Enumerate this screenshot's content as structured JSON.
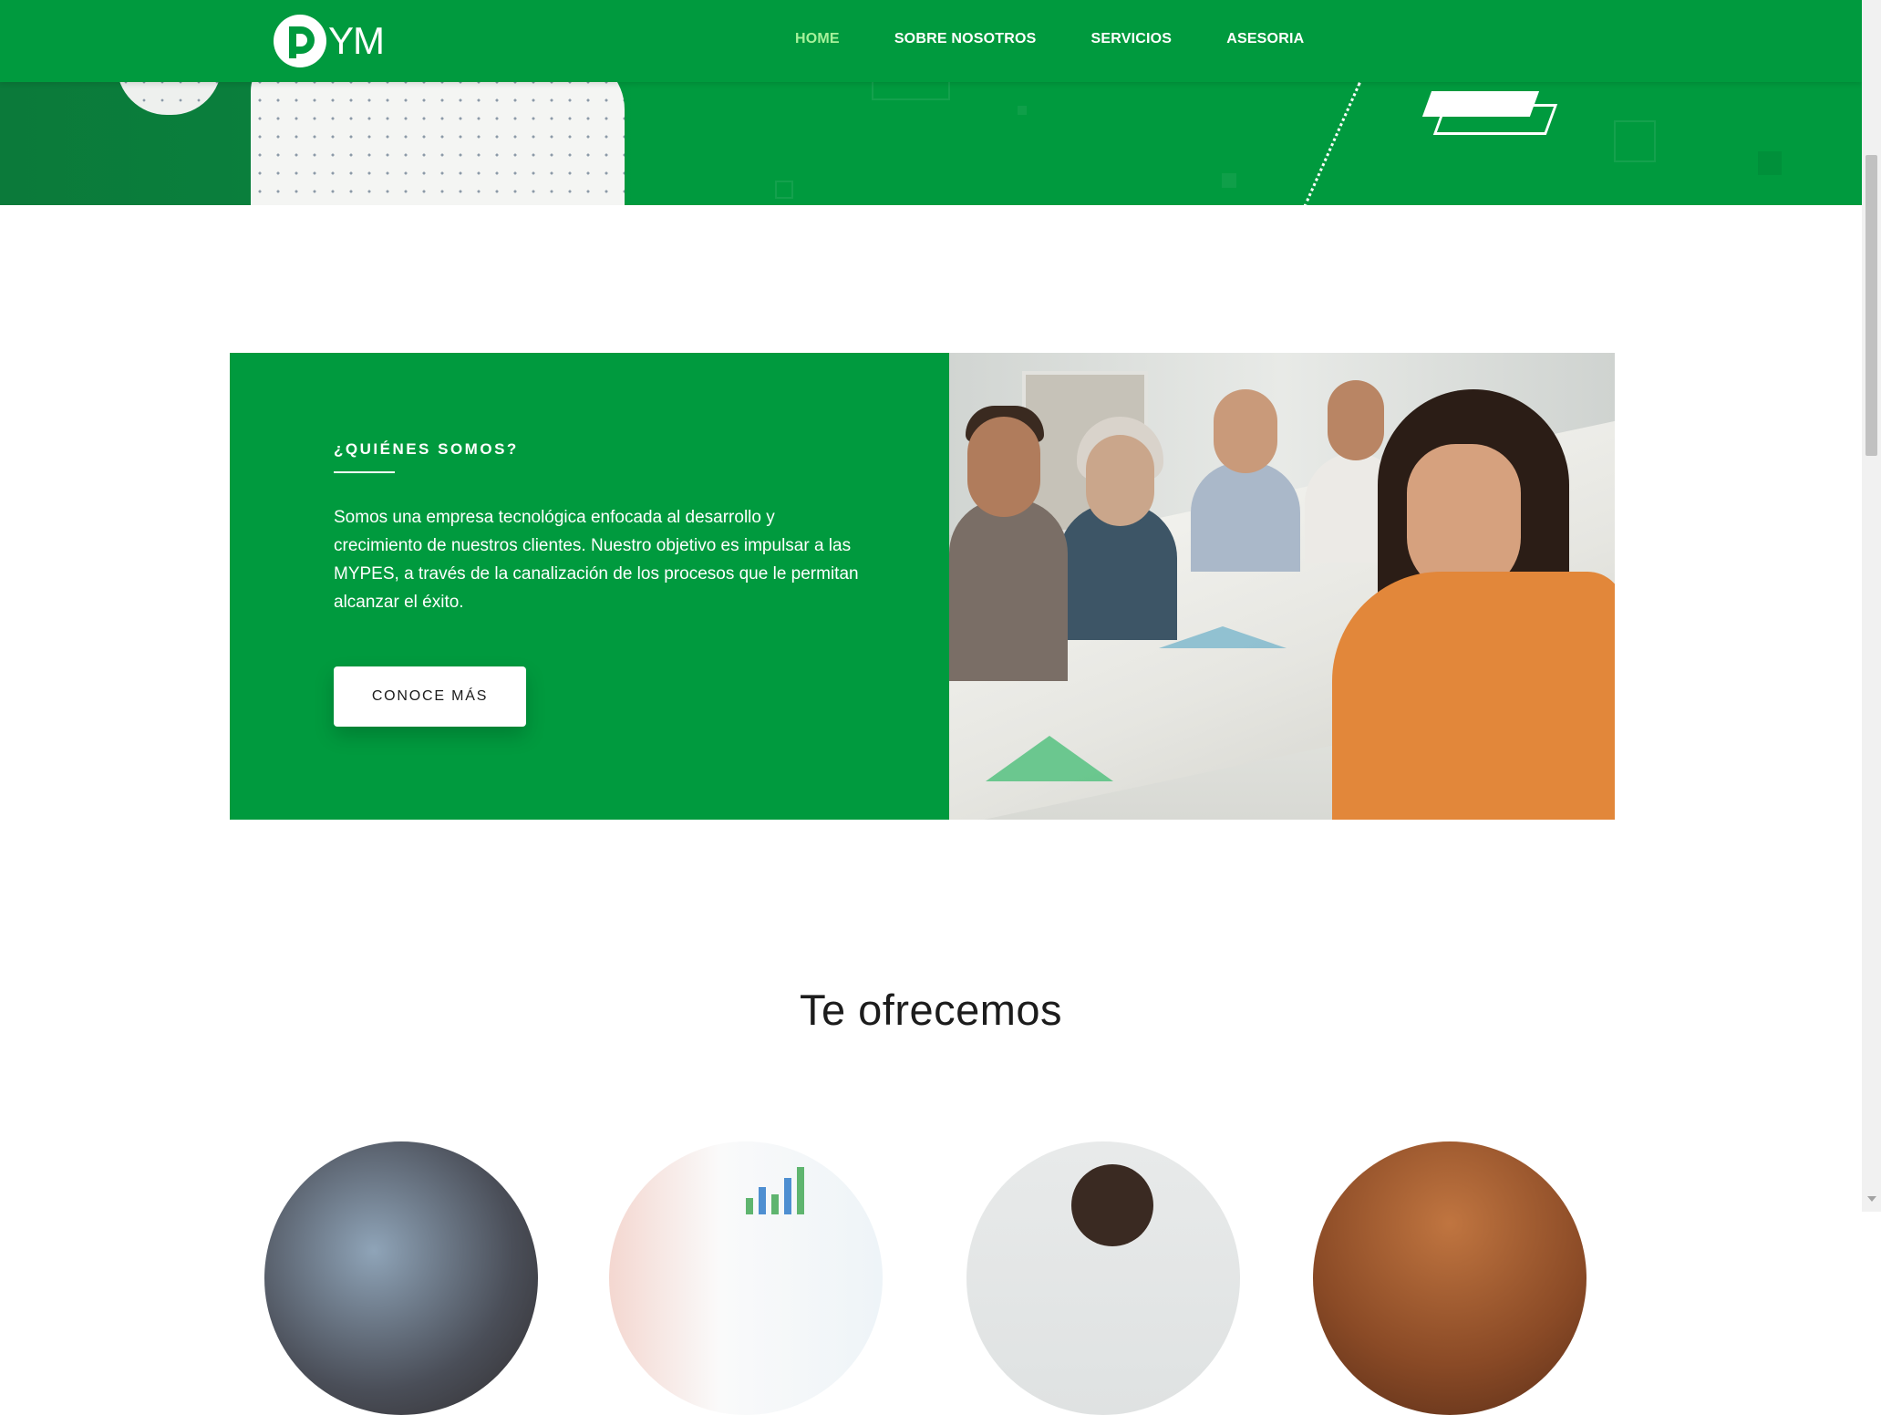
{
  "brand": {
    "logo_text": "YM"
  },
  "nav": {
    "items": [
      {
        "label": "HOME",
        "active": true
      },
      {
        "label": "SOBRE NOSOTROS",
        "active": false
      },
      {
        "label": "SERVICIOS",
        "active": false
      },
      {
        "label": "ASESORIA",
        "active": false
      }
    ]
  },
  "about": {
    "kicker": "¿QUIÉNES SOMOS?",
    "text": "Somos una empresa tecnológica enfocada al desarrollo y crecimiento de nuestros clientes. Nuestro objetivo es impulsar a las MYPES, a través de la canalización de los procesos que le permitan alcanzar el éxito.",
    "button_label": "CONOCE MÁS"
  },
  "offer": {
    "title": "Te ofrecemos"
  },
  "colors": {
    "brand_green": "#009a3e",
    "active_nav": "#a6f19b",
    "text_dark": "#1c1c1c"
  }
}
